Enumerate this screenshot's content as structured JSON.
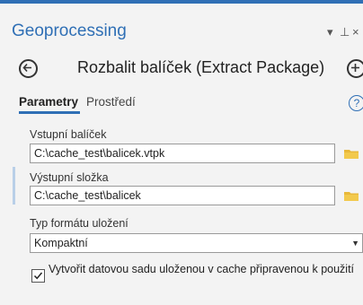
{
  "pane": {
    "title": "Geoprocessing",
    "menu_glyph": "▾",
    "pin_glyph": "⊥",
    "close_glyph": "×"
  },
  "tool": {
    "name": "Rozbalit balíček (Extract Package)",
    "back_icon": "back-arrow-circle-icon",
    "add_icon": "plus-circle-icon"
  },
  "tabs": [
    {
      "label": "Parametry",
      "active": true
    },
    {
      "label": "Prostředí",
      "active": false
    }
  ],
  "help": {
    "glyph": "?"
  },
  "params": {
    "input_label": "Vstupní balíček",
    "input_value": "C:\\cache_test\\balicek.vtpk",
    "output_label": "Výstupní složka",
    "output_value": "C:\\cache_test\\balicek",
    "format_label": "Typ formátu uložení",
    "format_value": "Kompaktní",
    "checkbox_label": "Vytvořit datovou sadu uloženou v cache připravenou k použití",
    "checkbox_checked": true
  },
  "colors": {
    "accent": "#2f6fb5",
    "folder": "#e8b83a"
  }
}
